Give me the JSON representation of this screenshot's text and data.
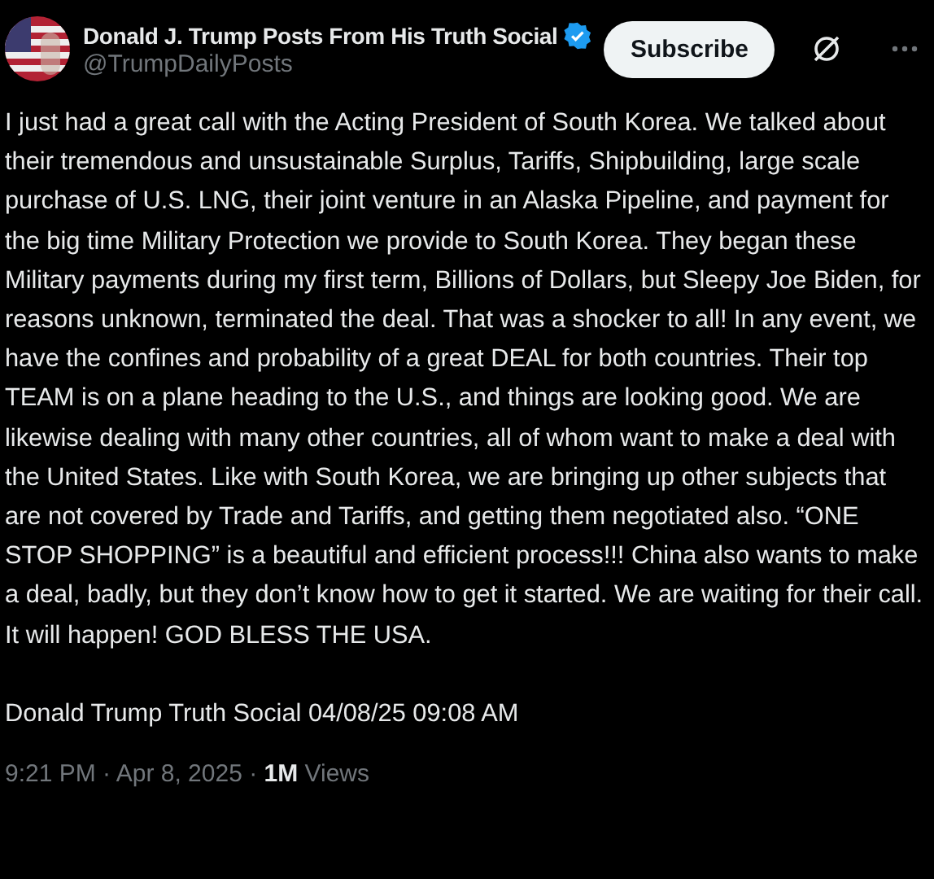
{
  "author": {
    "name": "Donald J. Trump Posts From His Truth Social",
    "verified": true,
    "handle": "@TrumpDailyPosts"
  },
  "subscribe_button": "Subscribe",
  "post": {
    "paragraphs": [
      "I just had a great call with the Acting President of South Korea. We talked about their tremendous and unsustainable Surplus, Tariffs, Shipbuilding, large scale purchase of U.S. LNG, their joint venture in an Alaska Pipeline, and payment for the big time Military Protection we provide to South Korea. They began these Military payments during my first term, Billions of Dollars, but Sleepy Joe Biden, for reasons unknown, terminated the deal. That was a shocker to all! In any event, we have the confines and probability of a great DEAL for both countries. Their top TEAM is on a plane heading to the U.S., and things are looking good. We are likewise dealing with many other countries, all of whom want to make a deal with the United States. Like with South Korea, we are bringing up other subjects that are not covered by Trade and Tariffs, and getting them negotiated also. “ONE STOP SHOPPING” is a beautiful and efficient process!!! China also wants to make a deal, badly, but they don’t know how to get it started. We are waiting for their call. It will happen! GOD BLESS THE USA.",
      "Donald Trump Truth Social 04/08/25 09:08 AM"
    ]
  },
  "meta": "9:21 PM · Apr 8, 2025 · **1M** Views"
}
